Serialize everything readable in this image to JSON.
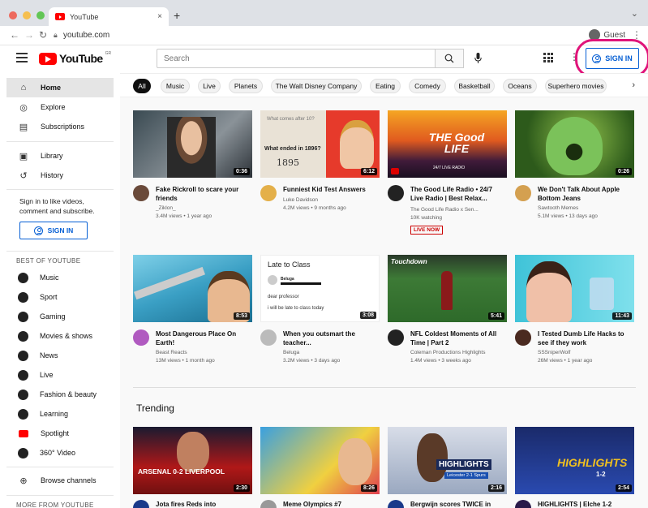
{
  "browser": {
    "tab_title": "YouTube",
    "tab_close": "×",
    "new_tab": "+",
    "url": "youtube.com",
    "guest_label": "Guest",
    "traffic_lights": [
      "#ed6a5e",
      "#f5bf4f",
      "#62c655"
    ]
  },
  "header": {
    "logo_text": "YouTube",
    "logo_region": "GR",
    "search_placeholder": "Search",
    "signin_label": "SIGN IN",
    "accent_color": "#065fd4",
    "highlight_color": "#e0147a"
  },
  "sidebar": {
    "nav": [
      {
        "label": "Home",
        "icon": "home-icon",
        "glyph": "⌂"
      },
      {
        "label": "Explore",
        "icon": "compass-icon",
        "glyph": "◎"
      },
      {
        "label": "Subscriptions",
        "icon": "subscriptions-icon",
        "glyph": "▤"
      }
    ],
    "library": [
      {
        "label": "Library",
        "icon": "library-icon",
        "glyph": "▣"
      },
      {
        "label": "History",
        "icon": "history-icon",
        "glyph": "↺"
      }
    ],
    "signin_prompt": "Sign in to like videos, comment and subscribe.",
    "signin_label": "SIGN IN",
    "best_of_heading": "BEST OF YOUTUBE",
    "best_of": [
      {
        "label": "Music",
        "icon": "music-icon"
      },
      {
        "label": "Sport",
        "icon": "sport-icon"
      },
      {
        "label": "Gaming",
        "icon": "gaming-icon"
      },
      {
        "label": "Movies & shows",
        "icon": "movies-icon"
      },
      {
        "label": "News",
        "icon": "news-icon"
      },
      {
        "label": "Live",
        "icon": "live-icon"
      },
      {
        "label": "Fashion & beauty",
        "icon": "fashion-icon"
      },
      {
        "label": "Learning",
        "icon": "learning-icon"
      },
      {
        "label": "Spotlight",
        "icon": "spotlight-icon"
      },
      {
        "label": "360° Video",
        "icon": "360-video-icon"
      }
    ],
    "browse_channels": "Browse channels",
    "more_heading": "MORE FROM YOUTUBE"
  },
  "chips": [
    "All",
    "Music",
    "Live",
    "Planets",
    "The Walt Disney Company",
    "Eating",
    "Comedy",
    "Basketball",
    "Oceans",
    "Superhero movies"
  ],
  "videos": [
    {
      "title": "Fake Rickroll to scare your friends",
      "channel": "_Ziklon_",
      "meta": "3.4M views • 1 year ago",
      "duration": "0:36",
      "verified": false
    },
    {
      "title": "Funniest Kid Test Answers",
      "channel": "Luke Davidson",
      "meta": "4.2M views • 9 months ago",
      "duration": "6:12",
      "verified": true
    },
    {
      "title": "The Good Life Radio • 24/7 Live Radio | Best Relax...",
      "channel": "The Good Life Radio x Sen...",
      "meta": "10K watching",
      "duration": "",
      "verified": true,
      "live": "LIVE NOW"
    },
    {
      "title": "We Don't Talk About Apple Bottom Jeans",
      "channel": "Sawtooth Memes",
      "meta": "5.1M views • 13 days ago",
      "duration": "0:26",
      "verified": false
    },
    {
      "title": "Most Dangerous Place On Earth!",
      "channel": "Beast Reacts",
      "meta": "13M views • 1 month ago",
      "duration": "8:53",
      "verified": true
    },
    {
      "title": "When you outsmart the teacher...",
      "channel": "Beluga",
      "meta": "3.2M views • 3 days ago",
      "duration": "3:08",
      "verified": true
    },
    {
      "title": "NFL Coldest Moments of All Time | Part 2",
      "channel": "Coleman Productions Highlights",
      "meta": "1.4M views • 3 weeks ago",
      "duration": "5:41",
      "verified": false
    },
    {
      "title": "I Tested Dumb Life Hacks to see if they work",
      "channel": "SSSniperWolf",
      "meta": "26M views • 1 year ago",
      "duration": "11:43",
      "verified": true
    }
  ],
  "trending_heading": "Trending",
  "trending": [
    {
      "title": "Jota fires Reds into",
      "duration": "2:30",
      "thumb_text": "ARSENAL 0-2 LIVERPOOL"
    },
    {
      "title": "Meme Olympics #7",
      "duration": "8:26",
      "thumb_text": ""
    },
    {
      "title": "Bergwijn scores TWICE in",
      "duration": "2:16",
      "thumb_text": "HIGHLIGHTS"
    },
    {
      "title": "HIGHLIGHTS | Elche 1-2",
      "duration": "2:54",
      "thumb_text": "HIGHLIGHTS"
    }
  ],
  "thumb_texts": {
    "goodlife": "THE Good LIFE",
    "goodlife_sub": "24/7 LIVE RADIO",
    "late_to_class": "Late to Class",
    "beluga_sender": "Beluga",
    "beluga_msg1": "dear professor",
    "beluga_msg2": "i will be late to class today",
    "touchdown": "Touchdown",
    "kid_test1": "What ended in 1896?",
    "kid_test2": "1895",
    "kid_test3": "What comes after 10?",
    "leicester": "Leicester 2-1 Spurs",
    "highlights_score": "1-2"
  }
}
